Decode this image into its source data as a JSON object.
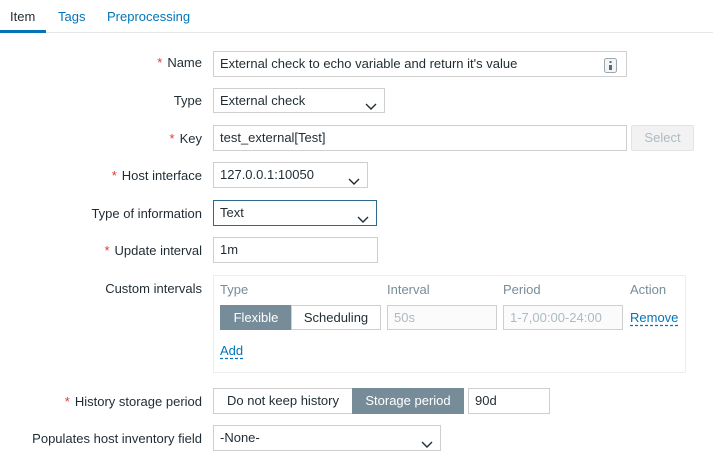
{
  "tabs": [
    "Item",
    "Tags",
    "Preprocessing"
  ],
  "form": {
    "name": {
      "label": "Name",
      "required": "*",
      "value": "External check to echo variable and return it's value"
    },
    "type": {
      "label": "Type",
      "value": "External check"
    },
    "key": {
      "label": "Key",
      "required": "*",
      "value": "test_external[Test]",
      "select_button": "Select"
    },
    "host_interface": {
      "label": "Host interface",
      "required": "*",
      "value": "127.0.0.1:10050"
    },
    "type_of_information": {
      "label": "Type of information",
      "value": "Text"
    },
    "update_interval": {
      "label": "Update interval",
      "required": "*",
      "value": "1m"
    },
    "custom_intervals": {
      "label": "Custom intervals",
      "columns": [
        "Type",
        "Interval",
        "Period",
        "Action"
      ],
      "row": {
        "type_options": [
          "Flexible",
          "Scheduling"
        ],
        "interval_placeholder": "50s",
        "period_placeholder": "1-7,00:00-24:00",
        "action": "Remove"
      },
      "add": "Add"
    },
    "history": {
      "label": "History storage period",
      "required": "*",
      "options": [
        "Do not keep history",
        "Storage period"
      ],
      "value": "90d"
    },
    "inventory": {
      "label": "Populates host inventory field",
      "value": "-None-"
    }
  },
  "colors": {
    "accent": "#0275b8",
    "required": "#e33734",
    "segment_active": "#768d99"
  },
  "icons": {
    "name_field": "context-menu-icon",
    "dropdown": "chevron-down-icon"
  }
}
